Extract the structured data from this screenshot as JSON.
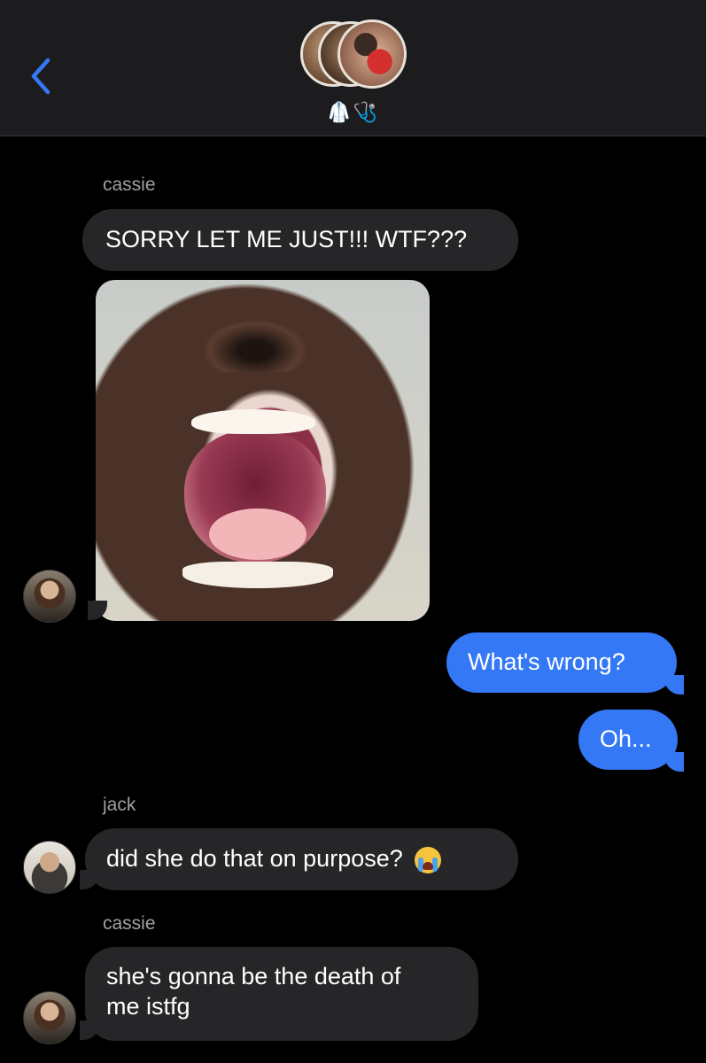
{
  "header": {
    "subtitle_emoji": "🥼🩺",
    "back_icon": "chevron-left-icon",
    "accent_color": "#3478f6",
    "group_avatars": [
      "participant-avatar-1",
      "participant-avatar-2",
      "participant-avatar-3"
    ]
  },
  "messages": [
    {
      "sender": "cassie",
      "type": "text",
      "text": "SORRY LET ME JUST!!! WTF???",
      "direction": "incoming"
    },
    {
      "sender": "cassie",
      "type": "image",
      "direction": "incoming"
    },
    {
      "type": "text",
      "text": "What's wrong?",
      "direction": "outgoing"
    },
    {
      "type": "text",
      "text": "Oh...",
      "direction": "outgoing"
    },
    {
      "sender": "jack",
      "type": "text",
      "text": "did she do that on purpose?",
      "emoji": "loudly-crying-face-icon",
      "direction": "incoming"
    },
    {
      "sender": "cassie",
      "type": "text",
      "text_line1": "she's gonna be the death of",
      "text_line2": "me istfg",
      "direction": "incoming"
    }
  ],
  "colors": {
    "incoming_bubble": "#262629",
    "outgoing_bubble": "#3478f6",
    "header_bg": "#1c1c1e"
  }
}
